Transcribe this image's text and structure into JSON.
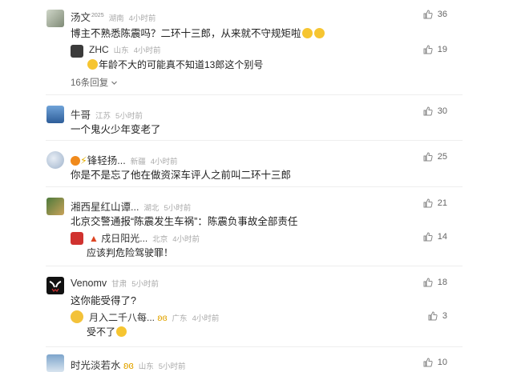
{
  "comments": [
    {
      "name": "汤文",
      "badge": "2025",
      "location": "湖南",
      "time": "4小时前",
      "text": "博主不熟悉陈震吗？二环十三郎，从来就不守规矩啦",
      "likes": "36",
      "replies": [
        {
          "name": "ZHC",
          "location": "山东",
          "time": "4小时前",
          "text": "年龄不大的可能真不知道13郎这个别号",
          "likes": "19"
        }
      ],
      "more_replies": "16条回复"
    },
    {
      "name": "牛哥",
      "location": "江苏",
      "time": "5小时前",
      "text": "一个鬼火少年变老了",
      "likes": "30"
    },
    {
      "name": "锋轻扬...",
      "location": "新疆",
      "time": "4小时前",
      "text": "你是不是忘了他在做资深车评人之前叫二环十三郎",
      "likes": "25"
    },
    {
      "name": "湘西星红山谭...",
      "location": "湖北",
      "time": "5小时前",
      "text": "北京交警通报“陈震发生车祸”：陈震负事故全部责任",
      "likes": "21",
      "replies": [
        {
          "name": "戍日阳光...",
          "location": "北京",
          "time": "4小时前",
          "text": "应该判危险驾驶罪！",
          "likes": "14"
        }
      ]
    },
    {
      "name": "Venomv",
      "location": "甘肃",
      "time": "5小时前",
      "text": "这你能受得了?",
      "likes": "18",
      "replies": [
        {
          "name": "月入二千八每...",
          "location": "广东",
          "time": "4小时前",
          "text": "受不了",
          "likes": "3"
        }
      ]
    },
    {
      "name": "时光淡若水",
      "location": "山东",
      "time": "5小时前",
      "likes": "10"
    }
  ]
}
